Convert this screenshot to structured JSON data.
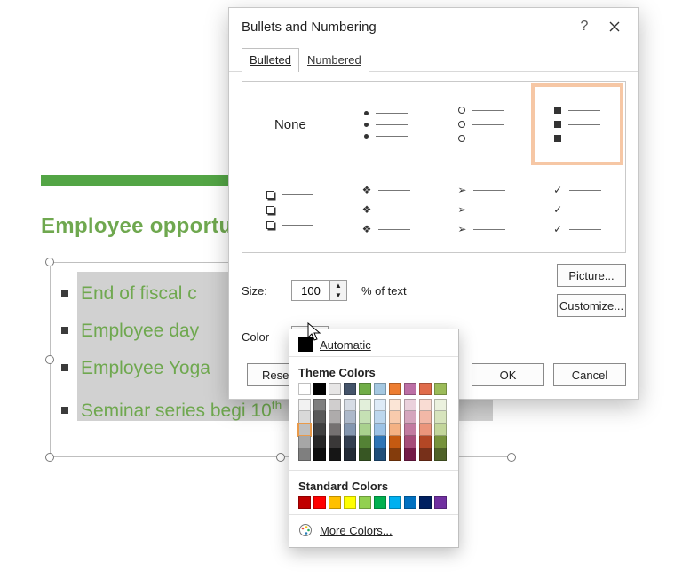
{
  "slide": {
    "title": "Employee opportu",
    "items": [
      {
        "text_html": "End of fiscal c"
      },
      {
        "text_html": "Employee day"
      },
      {
        "text_html": "Employee Yoga"
      },
      {
        "text_html": "Seminar series begi                          10<sup>th</sup>"
      }
    ]
  },
  "dialog": {
    "title": "Bullets and Numbering",
    "help": "?",
    "tabs": {
      "bulleted": "Bulleted",
      "numbered": "Numbered"
    },
    "none_label": "None",
    "size_label": "Size:",
    "size_value": "100",
    "pct_label": "% of text",
    "color_label": "Color",
    "picture_btn": "Picture...",
    "customize_btn": "Customize...",
    "reset_btn": "Reset",
    "ok_btn": "OK",
    "cancel_btn": "Cancel"
  },
  "color_panel": {
    "automatic": "Automatic",
    "theme_head": "Theme Colors",
    "theme_row": [
      "#ffffff",
      "#000000",
      "#e7e6e6",
      "#44546a",
      "#70ad47",
      "#a5c8e1",
      "#ed7d31",
      "#bc6fa5",
      "#e06c4b",
      "#9bbb59"
    ],
    "shade_cols": [
      [
        "#f2f2f2",
        "#d9d9d9",
        "#bfbfbf",
        "#a6a6a6",
        "#7f7f7f"
      ],
      [
        "#7f7f7f",
        "#595959",
        "#404040",
        "#262626",
        "#0d0d0d"
      ],
      [
        "#d0cece",
        "#aeabab",
        "#757171",
        "#3a3838",
        "#161616"
      ],
      [
        "#d6dce5",
        "#adb9ca",
        "#8497b0",
        "#333f50",
        "#222a35"
      ],
      [
        "#e2efda",
        "#c5e0b4",
        "#a9d18e",
        "#548235",
        "#375623"
      ],
      [
        "#deebf7",
        "#bdd7ee",
        "#9dc3e6",
        "#2e75b6",
        "#1f4e79"
      ],
      [
        "#fbe5d6",
        "#f8cbad",
        "#f4b183",
        "#c55a11",
        "#843c0c"
      ],
      [
        "#ead1dc",
        "#d5a6bd",
        "#c27ba0",
        "#a64d79",
        "#741b47"
      ],
      [
        "#f9dcd3",
        "#f2b8a7",
        "#eb957b",
        "#b34725",
        "#77301a"
      ],
      [
        "#ebf1de",
        "#d7e4bd",
        "#c3d69b",
        "#77933c",
        "#4f6228"
      ]
    ],
    "standard_head": "Standard Colors",
    "standard_row": [
      "#c00000",
      "#ff0000",
      "#ffc000",
      "#ffff00",
      "#92d050",
      "#00b050",
      "#00b0f0",
      "#0070c0",
      "#002060",
      "#7030a0"
    ],
    "more_colors": "More Colors..."
  }
}
